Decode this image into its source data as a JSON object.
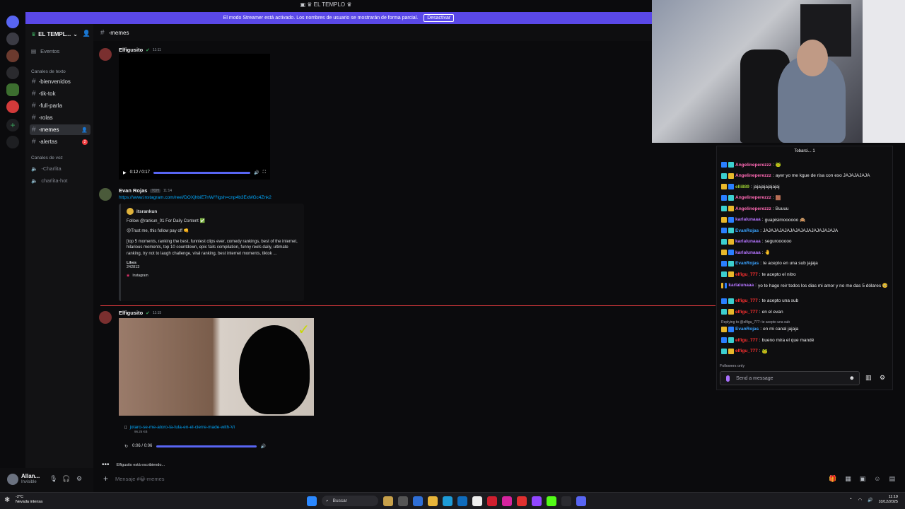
{
  "window": {
    "title": "EL TEMPLO"
  },
  "streamer_bar": {
    "text": "El modo Streamer está activado. Los nombres de usuario se mostrarán de forma parcial.",
    "button": "Desactivar"
  },
  "server": {
    "name": "EL TEMPL..."
  },
  "sidebar": {
    "events": "Eventos",
    "text_category": "Canales de texto",
    "channels": [
      {
        "name": "-bienvenidos"
      },
      {
        "name": "-tik-tok"
      },
      {
        "name": "-full-parla"
      },
      {
        "name": "-rolas"
      },
      {
        "name": "-memes"
      },
      {
        "name": "-alertas",
        "badge": "2"
      }
    ],
    "voice_category": "Canales de voz",
    "voice_channels": [
      "-Charlita",
      "charlita-hot"
    ]
  },
  "user": {
    "name": "Allan...",
    "status": "Invisible"
  },
  "chat": {
    "channel": "-memes",
    "messages": [
      {
        "author": "Elfigusito",
        "time": "11:11",
        "video_time": "0:12 / 0:17"
      },
      {
        "author": "Evan Rojas",
        "tag": "TOH",
        "time": "11:14",
        "link": "https://www.instagram.com/reel/DOXjhbiE7nW/?igsh=cnp4b3ExMGc4Znk2",
        "embed": {
          "author": "itsrankun",
          "line1": "Follow @rankun_01 For Daily Content ✅",
          "line2": "😲Trust me, this follow pay off 👊",
          "body": "[top 5 moments, ranking the best, funniest clips ever, comedy rankings, best of the internet, hilarious moments, top 10 countdown, epic fails compilation, funny reels daily, ultimate ranking, try not to laugh challenge, viral ranking, best internet moments, tiktok ...",
          "likes_label": "Likes",
          "likes": "242813",
          "footer": "Instagram"
        }
      },
      {
        "author": "Elfigusito",
        "time": "11:15",
        "file": "jotaro-se-me-atoro-la-tula-en-el-cierre-made-with-Vi",
        "file_size": "96.25 KB",
        "audio_time": "0:06 / 0:06"
      }
    ],
    "typing": "Elfigusito está escribiendo...",
    "composer_placeholder": "Mensaje #😀-memes"
  },
  "twitch_chat": {
    "pinned": "Tobarci... 1",
    "lines": [
      {
        "user": "Angelineperezzz",
        "color": "#ff69b4",
        "text": "🐸"
      },
      {
        "user": "Angelineperezzz",
        "color": "#ff69b4",
        "text": "ayer yo me kgue de risa con eso JAJAJAJAJA"
      },
      {
        "user": "elli889",
        "color": "#9acd32",
        "text": "jajajajajajajaj"
      },
      {
        "user": "Angelineperezzz",
        "color": "#ff69b4",
        "text": "🟫"
      },
      {
        "user": "Angelineperezzz",
        "color": "#ff69b4",
        "text": "Buuuu"
      },
      {
        "user": "karlalunaaa",
        "color": "#b574ff",
        "text": "guapisimoooooo 🙈"
      },
      {
        "user": "EvanRojas",
        "color": "#3aa3ff",
        "text": "JAJAJAJAJAJAJAJAJAJAJAJAJAJA"
      },
      {
        "user": "karlalunaaa",
        "color": "#b574ff",
        "text": "seguroooooo"
      },
      {
        "user": "karlalunaaa",
        "color": "#b574ff",
        "text": "🤚"
      },
      {
        "user": "EvanRojas",
        "color": "#3aa3ff",
        "text": "te acepto en una sub jajaja"
      },
      {
        "user": "elfigu_777",
        "color": "#ff3030",
        "text": "te acepto el nitro"
      },
      {
        "user": "karlalunaaa",
        "color": "#b574ff",
        "text": "yo te hago reir todos los dias mi amor y no me das 5 dólares 🥺"
      },
      {
        "user": "elfigu_777",
        "color": "#ff3030",
        "text": "te acepto una sub"
      },
      {
        "user": "elfigu_777",
        "color": "#ff3030",
        "text": "en el evan"
      },
      {
        "user": "EvanRojas",
        "color": "#3aa3ff",
        "text": "en mi canal jajaja",
        "reply": "Replying to @elfigu_777: te acepto una sub"
      },
      {
        "user": "elfigu_777",
        "color": "#ff3030",
        "text": "bueno mira el que mandé"
      },
      {
        "user": "elfigu_777",
        "color": "#ff3030",
        "text": "🐸"
      }
    ],
    "followers_only": "Followers only",
    "input_placeholder": "Send a message"
  },
  "taskbar": {
    "weather_temp": "-2°C",
    "weather_desc": "Nevada intensa",
    "search": "Buscar",
    "time": "11:19",
    "date": "10/12/2025"
  },
  "colors": {
    "accent": "#5865f2",
    "streamer_bar": "#5a48e8",
    "link": "#00a8fc",
    "unread_line": "#f23f42"
  }
}
